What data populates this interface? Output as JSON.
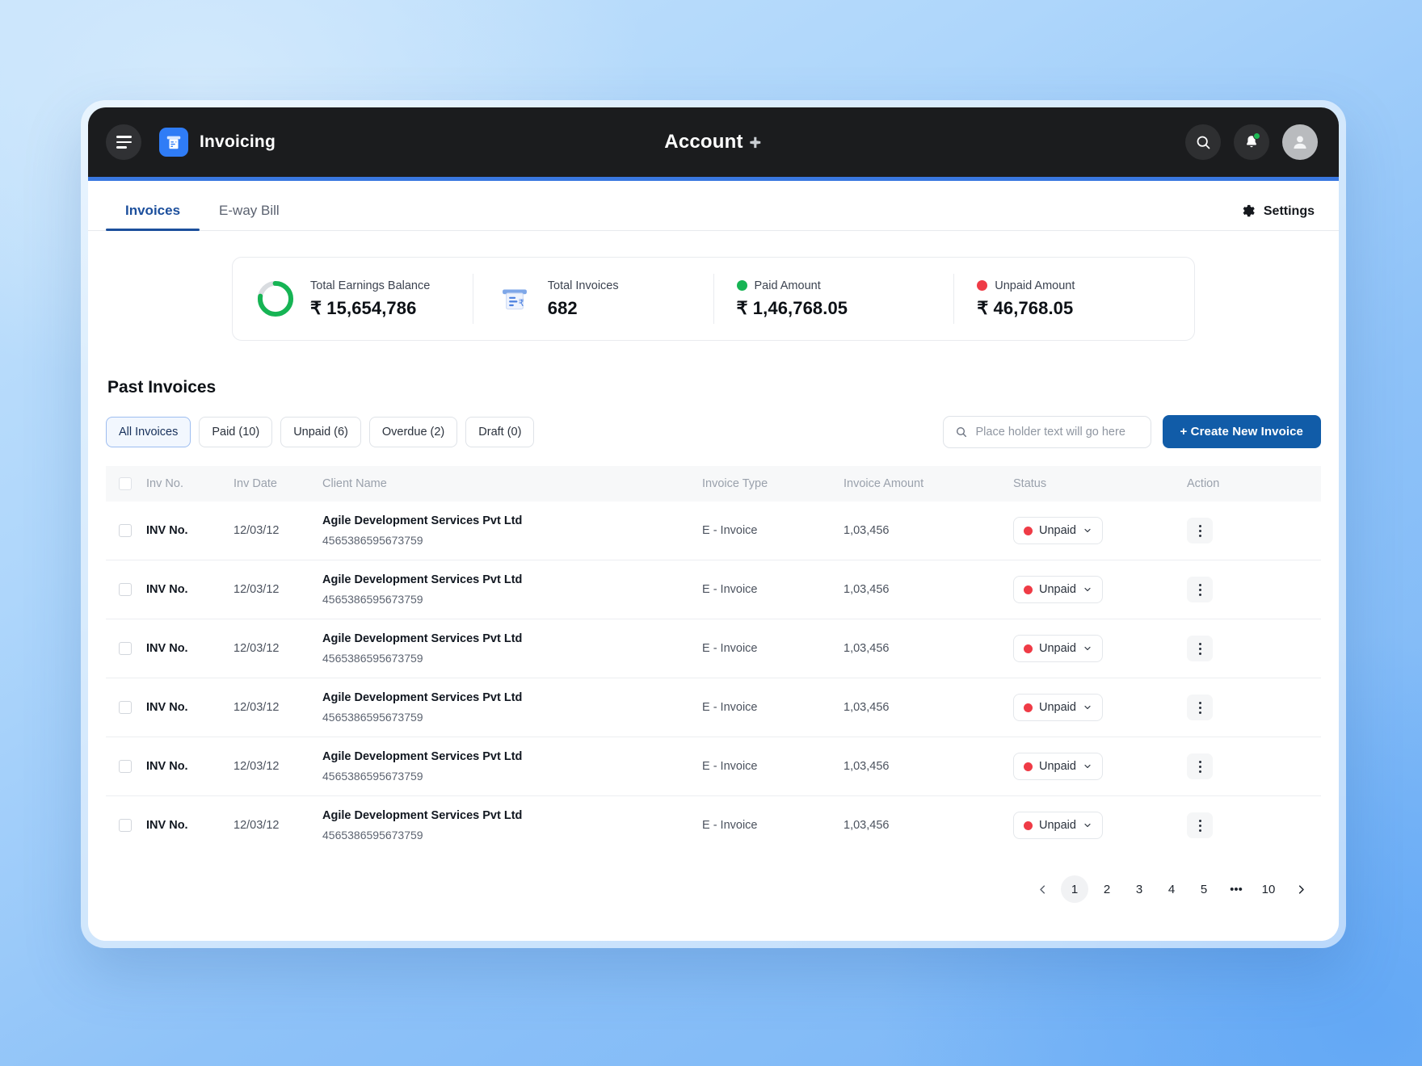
{
  "topbar": {
    "menu_icon": "hamburger-icon",
    "brand_logo_icon": "invoice-machine-icon",
    "brand_name": "Invoicing",
    "app_title": "Account",
    "app_title_mark": "✛",
    "search_icon": "search-icon",
    "notification_icon": "bell-icon",
    "avatar_icon": "user-avatar-icon"
  },
  "tabs": [
    {
      "label": "Invoices",
      "active": true
    },
    {
      "label": "E-way Bill",
      "active": false
    }
  ],
  "settings": {
    "label": "Settings",
    "icon": "gear-icon"
  },
  "stats": [
    {
      "label": "Total Earnings Balance",
      "value": "₹ 15,654,786",
      "visual": "donut-chart",
      "accent": "#1db954",
      "track": "#d9dce0",
      "percent": 78
    },
    {
      "label": "Total Invoices",
      "value": "682",
      "visual": "invoice-icon",
      "accent": "#4a7fe0"
    },
    {
      "label": "Paid Amount",
      "value": "₹ 1,46,768.05",
      "visual": "dot",
      "accent": "#1db954"
    },
    {
      "label": "Unpaid Amount",
      "value": "₹ 46,768.05",
      "visual": "dot",
      "accent": "#ef3b46"
    }
  ],
  "section": {
    "title": "Past Invoices"
  },
  "filters": [
    {
      "label": "All Invoices",
      "active": true
    },
    {
      "label": "Paid (10)",
      "active": false
    },
    {
      "label": "Unpaid (6)",
      "active": false
    },
    {
      "label": "Overdue (2)",
      "active": false
    },
    {
      "label": "Draft (0)",
      "active": false
    }
  ],
  "search": {
    "placeholder": "Place holder text will go here",
    "value": "",
    "icon": "search-icon"
  },
  "create_button": {
    "label": "+ Create New Invoice",
    "color": "#115ca8"
  },
  "table": {
    "columns": [
      "Inv No.",
      "Inv Date",
      "Client Name",
      "Invoice Type",
      "Invoice Amount",
      "Status",
      "Action"
    ],
    "rows": [
      {
        "inv_no": "INV No.",
        "inv_date": "12/03/12",
        "client_name": "Agile Development Services Pvt Ltd",
        "client_ref": "4565386595673759",
        "invoice_type": "E - Invoice",
        "invoice_amount": "1,03,456",
        "status": "Unpaid",
        "status_color": "#ef3b46"
      },
      {
        "inv_no": "INV No.",
        "inv_date": "12/03/12",
        "client_name": "Agile Development Services Pvt Ltd",
        "client_ref": "4565386595673759",
        "invoice_type": "E - Invoice",
        "invoice_amount": "1,03,456",
        "status": "Unpaid",
        "status_color": "#ef3b46"
      },
      {
        "inv_no": "INV No.",
        "inv_date": "12/03/12",
        "client_name": "Agile Development Services Pvt Ltd",
        "client_ref": "4565386595673759",
        "invoice_type": "E - Invoice",
        "invoice_amount": "1,03,456",
        "status": "Unpaid",
        "status_color": "#ef3b46"
      },
      {
        "inv_no": "INV No.",
        "inv_date": "12/03/12",
        "client_name": "Agile Development Services Pvt Ltd",
        "client_ref": "4565386595673759",
        "invoice_type": "E - Invoice",
        "invoice_amount": "1,03,456",
        "status": "Unpaid",
        "status_color": "#ef3b46"
      },
      {
        "inv_no": "INV No.",
        "inv_date": "12/03/12",
        "client_name": "Agile Development Services Pvt Ltd",
        "client_ref": "4565386595673759",
        "invoice_type": "E - Invoice",
        "invoice_amount": "1,03,456",
        "status": "Unpaid",
        "status_color": "#ef3b46"
      },
      {
        "inv_no": "INV No.",
        "inv_date": "12/03/12",
        "client_name": "Agile Development Services Pvt Ltd",
        "client_ref": "4565386595673759",
        "invoice_type": "E - Invoice",
        "invoice_amount": "1,03,456",
        "status": "Unpaid",
        "status_color": "#ef3b46"
      }
    ]
  },
  "pagination": {
    "prev_icon": "chevron-left-icon",
    "next_icon": "chevron-right-icon",
    "pages": [
      "1",
      "2",
      "3",
      "4",
      "5",
      "•••",
      "10"
    ],
    "current": "1"
  }
}
